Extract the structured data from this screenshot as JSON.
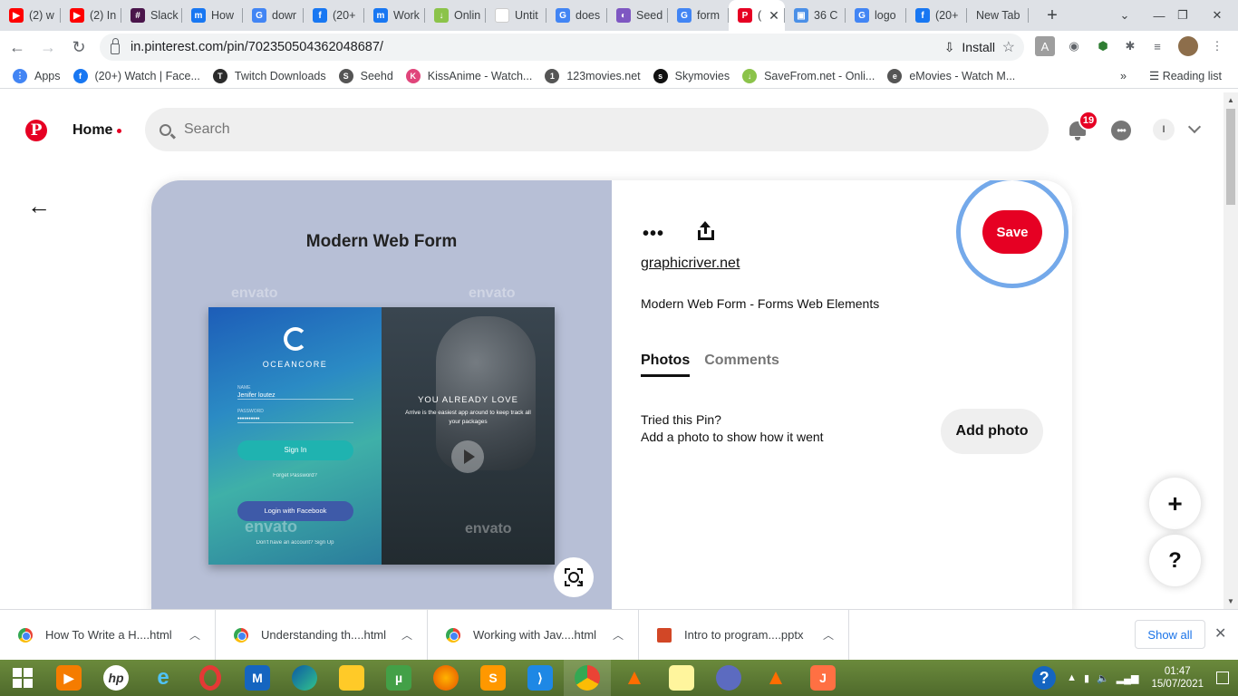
{
  "browser": {
    "tabs": [
      {
        "label": "(2) w",
        "fav_color": "#ff0000",
        "fav": "▶"
      },
      {
        "label": "(2) In",
        "fav_color": "#ff0000",
        "fav": "▶"
      },
      {
        "label": "Slack",
        "fav_color": "#4a154b",
        "fav": "#"
      },
      {
        "label": "How",
        "fav_color": "#1877f2",
        "fav": "m"
      },
      {
        "label": "dowr",
        "fav_color": "#4285f4",
        "fav": "G"
      },
      {
        "label": "(20+",
        "fav_color": "#1877f2",
        "fav": "f"
      },
      {
        "label": "Work",
        "fav_color": "#1877f2",
        "fav": "m"
      },
      {
        "label": "Onlin",
        "fav_color": "#8bc34a",
        "fav": "↓"
      },
      {
        "label": "Untit",
        "fav_color": "#ffffff",
        "fav": ""
      },
      {
        "label": "does",
        "fav_color": "#4285f4",
        "fav": "G"
      },
      {
        "label": "Seed",
        "fav_color": "#7e57c2",
        "fav": "◐"
      },
      {
        "label": "form",
        "fav_color": "#4285f4",
        "fav": "G"
      },
      {
        "label": "(",
        "fav_color": "#e60023",
        "fav": "P",
        "active": true
      },
      {
        "label": "36 C",
        "fav_color": "#4a8fe7",
        "fav": "▣"
      },
      {
        "label": "logo",
        "fav_color": "#4285f4",
        "fav": "G"
      },
      {
        "label": "(20+",
        "fav_color": "#1877f2",
        "fav": "f"
      },
      {
        "label": "New Tab",
        "fav_color": "",
        "fav": ""
      }
    ],
    "url": "in.pinterest.com/pin/702350504362048687/",
    "install_label": "Install",
    "bookmarks": [
      {
        "label": "Apps",
        "color": "#4285f4",
        "icon": "⋮"
      },
      {
        "label": "(20+) Watch | Face...",
        "color": "#1877f2",
        "icon": "f"
      },
      {
        "label": "Twitch Downloads",
        "color": "#2b2b2b",
        "icon": "T"
      },
      {
        "label": "Seehd",
        "color": "#555555",
        "icon": "S"
      },
      {
        "label": "KissAnime - Watch...",
        "color": "#e0457b",
        "icon": "K"
      },
      {
        "label": "123movies.net",
        "color": "#555555",
        "icon": "1"
      },
      {
        "label": "Skymovies",
        "color": "#111111",
        "icon": "s"
      },
      {
        "label": "SaveFrom.net - Onli...",
        "color": "#8bc34a",
        "icon": "↓"
      },
      {
        "label": "eMovies - Watch M...",
        "color": "#555555",
        "icon": "e"
      }
    ],
    "bookmarks_overflow": "»",
    "reading_list": "Reading list"
  },
  "pinterest": {
    "home_label": "Home",
    "search_placeholder": "Search",
    "notification_count": "19",
    "avatar_letter": "I",
    "image": {
      "title": "Modern Web Form",
      "brand": "OCEANCORE",
      "name_label": "NAME",
      "name_value": "Jenifer loutez",
      "password_label": "PASSWORD",
      "password_value": "••••••••••",
      "signin": "Sign In",
      "forgot": "Forget Password?",
      "facebook": "Login with Facebook",
      "no_account": "Don't have an account? Sign Up",
      "headline": "YOU ALREADY LOVE",
      "subline": "Arrive is the easiest app around to keep track all your packages",
      "watermark": "envato"
    },
    "save_label": "Save",
    "domain": "graphicriver.net",
    "pin_title": "Modern Web Form - Forms Web Elements",
    "tab_photos": "Photos",
    "tab_comments": "Comments",
    "tried_title": "Tried this Pin?",
    "tried_sub": "Add a photo to show how it went",
    "add_photo": "Add photo",
    "plus": "+",
    "help": "?"
  },
  "downloads": {
    "items": [
      {
        "name": "How To Write a H....html",
        "type": "chrome"
      },
      {
        "name": "Understanding th....html",
        "type": "chrome"
      },
      {
        "name": "Working with Jav....html",
        "type": "chrome"
      },
      {
        "name": "Intro to program....pptx",
        "type": "pptx"
      }
    ],
    "show_all": "Show all"
  },
  "taskbar": {
    "time": "01:47",
    "date": "15/07/2021"
  }
}
